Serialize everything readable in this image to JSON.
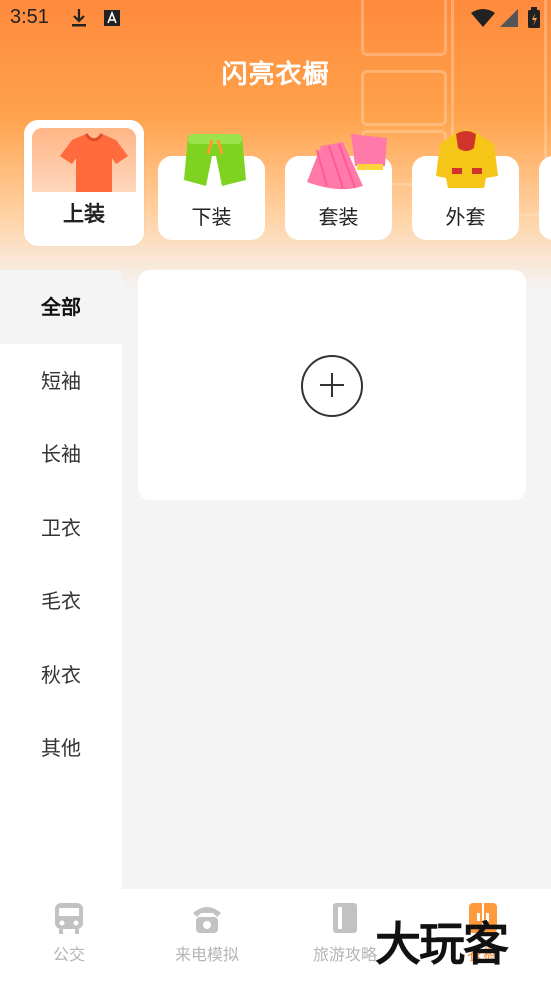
{
  "status": {
    "time": "3:51"
  },
  "header": {
    "title": "闪亮衣橱"
  },
  "categories": [
    {
      "label": "上装",
      "active": true
    },
    {
      "label": "下装"
    },
    {
      "label": "套装"
    },
    {
      "label": "外套"
    }
  ],
  "sidebar": {
    "items": [
      {
        "label": "全部",
        "selected": true
      },
      {
        "label": "短袖"
      },
      {
        "label": "长袖"
      },
      {
        "label": "卫衣"
      },
      {
        "label": "毛衣"
      },
      {
        "label": "秋衣"
      },
      {
        "label": "其他"
      }
    ]
  },
  "tabs": [
    {
      "label": "公交",
      "icon": "bus-icon"
    },
    {
      "label": "来电模拟",
      "icon": "phone-icon"
    },
    {
      "label": "旅游攻略",
      "icon": "book-icon"
    },
    {
      "label": "衣橱",
      "icon": "wardrobe-icon",
      "active": true
    }
  ],
  "watermark": "大玩客",
  "colors": {
    "accent": "#ff8c2d",
    "header": "#ff8a3d"
  }
}
